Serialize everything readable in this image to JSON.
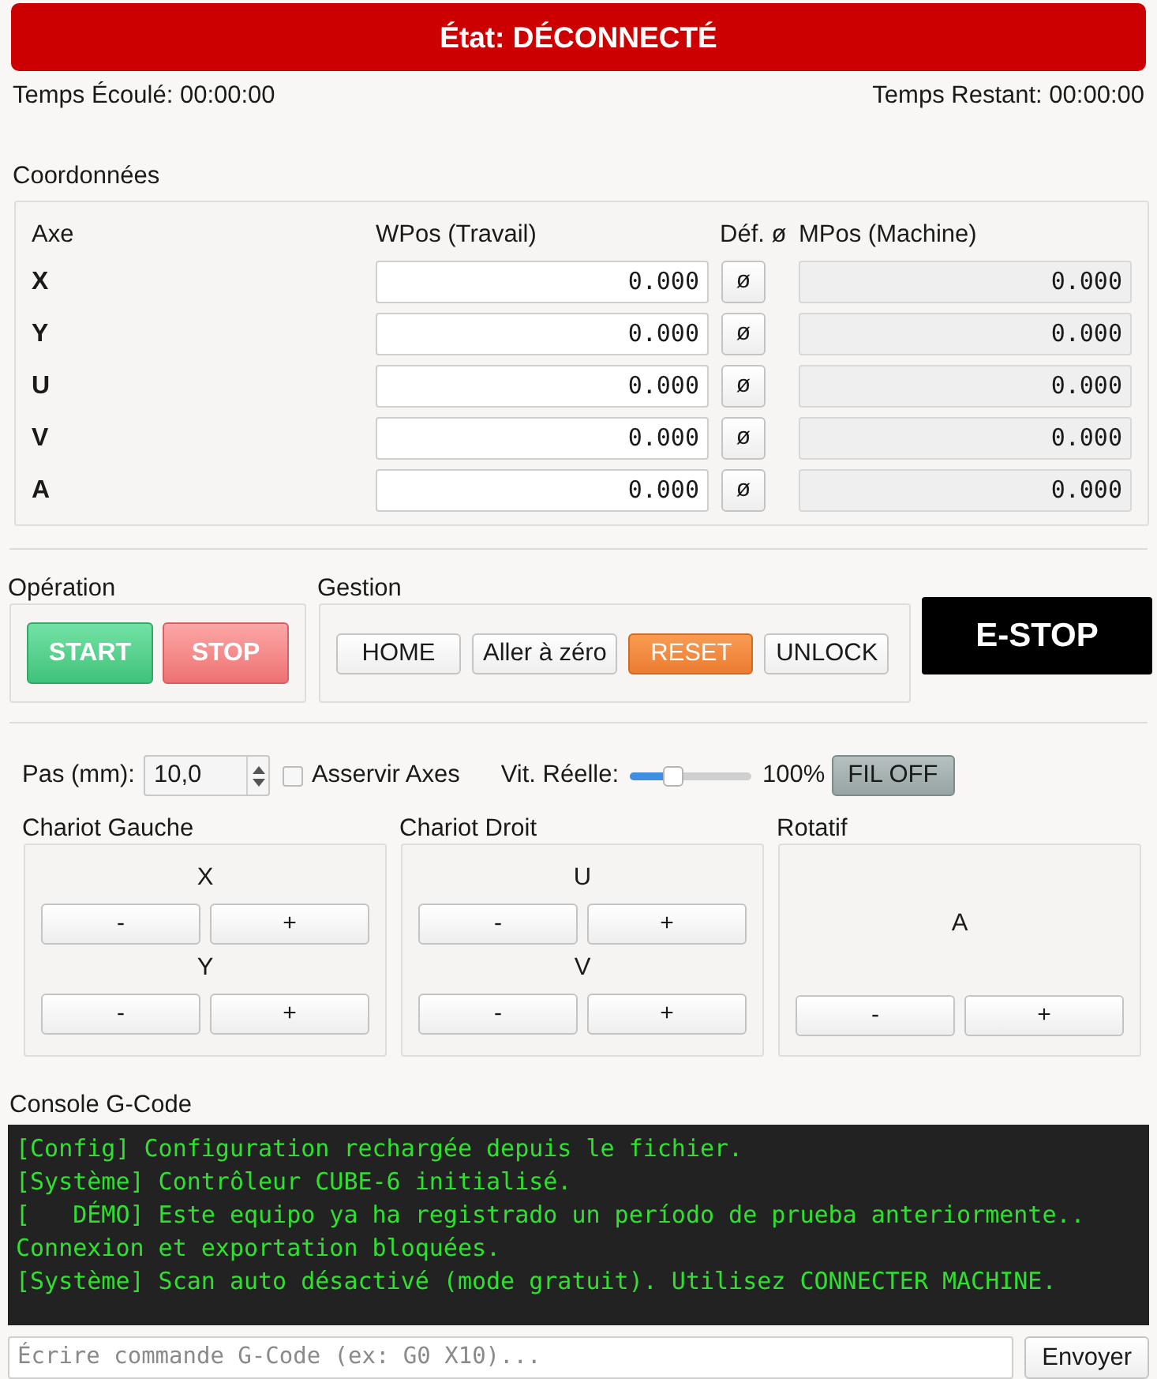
{
  "status": {
    "text": "État: DÉCONNECTÉ",
    "connected": false
  },
  "timers": {
    "elapsed": "Temps Écoulé: 00:00:00",
    "remaining": "Temps Restant: 00:00:00"
  },
  "coordinates": {
    "title": "Coordonnées",
    "columns": [
      "Axe",
      "WPos (Travail)",
      "Déf. ø",
      "MPos (Machine)"
    ],
    "rows": [
      {
        "axis": "X",
        "wpos": "0.000",
        "zero_button": "ø",
        "mpos": "0.000"
      },
      {
        "axis": "Y",
        "wpos": "0.000",
        "zero_button": "ø",
        "mpos": "0.000"
      },
      {
        "axis": "U",
        "wpos": "0.000",
        "zero_button": "ø",
        "mpos": "0.000"
      },
      {
        "axis": "V",
        "wpos": "0.000",
        "zero_button": "ø",
        "mpos": "0.000"
      },
      {
        "axis": "A",
        "wpos": "0.000",
        "zero_button": "ø",
        "mpos": "0.000"
      }
    ]
  },
  "operation": {
    "title": "Opération",
    "buttons": [
      {
        "label": "START",
        "kind": "start"
      },
      {
        "label": "STOP",
        "kind": "stop"
      }
    ]
  },
  "management": {
    "title": "Gestion",
    "buttons": [
      {
        "label": "HOME",
        "kind": "plain"
      },
      {
        "label": "Aller à zéro",
        "kind": "plain"
      },
      {
        "label": "RESET",
        "kind": "warning"
      },
      {
        "label": "UNLOCK",
        "kind": "plain"
      }
    ]
  },
  "estop": {
    "label": "E-STOP"
  },
  "controls": {
    "step_label": "Pas (mm):",
    "step_value": "10,0",
    "sync_axes": {
      "label": "Asservir Axes",
      "checked": false
    },
    "speed_label": "Vit. Réelle:",
    "speed_slider": {
      "level": 0.35
    },
    "speed_reading": "100%",
    "wire_button": "FIL OFF"
  },
  "jog_groups": [
    {
      "title": "Chariot Gauche",
      "axes": [
        {
          "label": "X",
          "minus": "-",
          "plus": "+"
        },
        {
          "label": "Y",
          "minus": "-",
          "plus": "+"
        }
      ]
    },
    {
      "title": "Chariot Droit",
      "axes": [
        {
          "label": "U",
          "minus": "-",
          "plus": "+"
        },
        {
          "label": "V",
          "minus": "-",
          "plus": "+"
        }
      ]
    },
    {
      "title": "Rotatif",
      "axes": [
        {
          "label": "A",
          "minus": "-",
          "plus": "+"
        }
      ]
    }
  ],
  "console": {
    "title": "Console G-Code",
    "lines": [
      "[Config] Configuration rechargée depuis le fichier.",
      "[Système] Contrôleur CUBE-6 initialisé.",
      "[   DÉMO] Este equipo ya ha registrado un período de prueba anteriormente..",
      "Connexion et exportation bloquées.",
      "[Système] Scan auto désactivé (mode gratuit). Utilisez CONNECTER MACHINE."
    ],
    "input": {
      "placeholder": "Écrire commande G-Code (ex: G0 X10)..."
    },
    "send_button": "Envoyer"
  }
}
